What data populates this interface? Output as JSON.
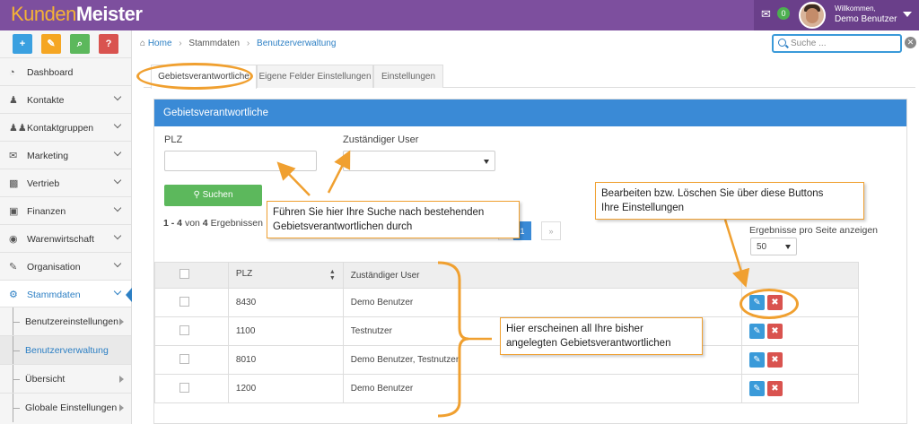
{
  "app": {
    "logo_part1": "Kunden",
    "logo_part2": "Meister"
  },
  "topbar": {
    "chat_count": "0",
    "welcome": "Willkommen,",
    "user": "Demo Benutzer"
  },
  "quick_actions": [
    "+",
    "✎",
    "⌕",
    "?"
  ],
  "sidebar": {
    "items": [
      {
        "label": "Dashboard",
        "icon": "dashboard-icon"
      },
      {
        "label": "Kontakte",
        "icon": "user-icon"
      },
      {
        "label": "Kontaktgruppen",
        "icon": "users-icon"
      },
      {
        "label": "Marketing",
        "icon": "envelope-icon"
      },
      {
        "label": "Vertrieb",
        "icon": "bar-chart-icon"
      },
      {
        "label": "Finanzen",
        "icon": "money-icon"
      },
      {
        "label": "Warenwirtschaft",
        "icon": "globe-icon"
      },
      {
        "label": "Organisation",
        "icon": "edit-icon"
      },
      {
        "label": "Stammdaten",
        "icon": "cogs-icon"
      }
    ],
    "subitems": [
      {
        "label": "Benutzereinstellungen"
      },
      {
        "label": "Benutzerverwaltung"
      },
      {
        "label": "Übersicht"
      },
      {
        "label": "Globale Einstellungen"
      }
    ]
  },
  "breadcrumb": {
    "home": "Home",
    "level1": "Stammdaten",
    "level2": "Benutzerverwaltung"
  },
  "search": {
    "placeholder": "Suche ..."
  },
  "tabs": [
    "Gebietsverantwortliche",
    "Eigene Felder Einstellungen",
    "Einstellungen"
  ],
  "panel": {
    "title": "Gebietsverantwortliche",
    "plz_label": "PLZ",
    "user_label": "Zuständiger User",
    "search_button": "Suchen",
    "results_range": "1 - 4",
    "results_von": "von",
    "results_total": "4",
    "results_suffix": "Ergebnissen",
    "page": "1",
    "pager_next": "»",
    "per_page_label": "Ergebnisse pro Seite anzeigen",
    "per_page_value": "50",
    "columns": {
      "plz": "PLZ",
      "user": "Zuständiger User"
    },
    "rows": [
      {
        "plz": "8430",
        "user": "Demo Benutzer"
      },
      {
        "plz": "1100",
        "user": "Testnutzer"
      },
      {
        "plz": "8010",
        "user": "Demo Benutzer, Testnutzer"
      },
      {
        "plz": "1200",
        "user": "Demo Benutzer"
      }
    ]
  },
  "annotations": {
    "search_hint_1": "Führen Sie hier Ihre Suche nach bestehenden",
    "search_hint_2": "Gebietsverantwortlichen durch",
    "buttons_hint_1": "Bearbeiten bzw. Löschen Sie über diese Buttons",
    "buttons_hint_2": "Ihre Einstellungen",
    "list_hint_1": "Hier erscheinen  all Ihre bisher",
    "list_hint_2": "angelegten Gebietsverantwortlichen"
  },
  "colors": {
    "topbar": "#7d4f9e",
    "accent": "#3a8ad6",
    "search_button": "#5cb85c",
    "delete": "#d9534f",
    "annotation": "#f0a030"
  }
}
